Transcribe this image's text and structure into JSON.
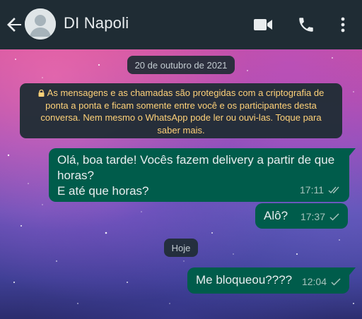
{
  "header": {
    "contact_name": "DI Napoli",
    "icons": [
      "back-arrow-icon",
      "avatar-icon",
      "video-call-icon",
      "voice-call-icon",
      "more-vert-icon"
    ]
  },
  "chat": {
    "date_label": "20 de outubro de 2021",
    "encryption_notice": "As mensagens e as chamadas são protegidas com a criptografia de ponta a ponta e ficam somente entre você e os participantes desta conversa. Nem mesmo o WhatsApp pode ler ou ouvi-las. Toque para saber mais.",
    "today_label": "Hoje",
    "messages": [
      {
        "text": "Olá, boa tarde! Vocês fazem delivery a partir de que horas?\nE até que horas?",
        "time": "17:11",
        "status": "double-check-icon"
      },
      {
        "text": "Alô?",
        "time": "17:37",
        "status": "single-check-icon"
      },
      {
        "text": "Me bloqueou????",
        "time": "12:04",
        "status": "single-check-icon"
      }
    ]
  },
  "colors": {
    "header_bg": "#1f2c34",
    "outgoing_bubble": "#005c4b",
    "notice_text": "#ffd279",
    "chip_text": "#c2cbd0"
  }
}
